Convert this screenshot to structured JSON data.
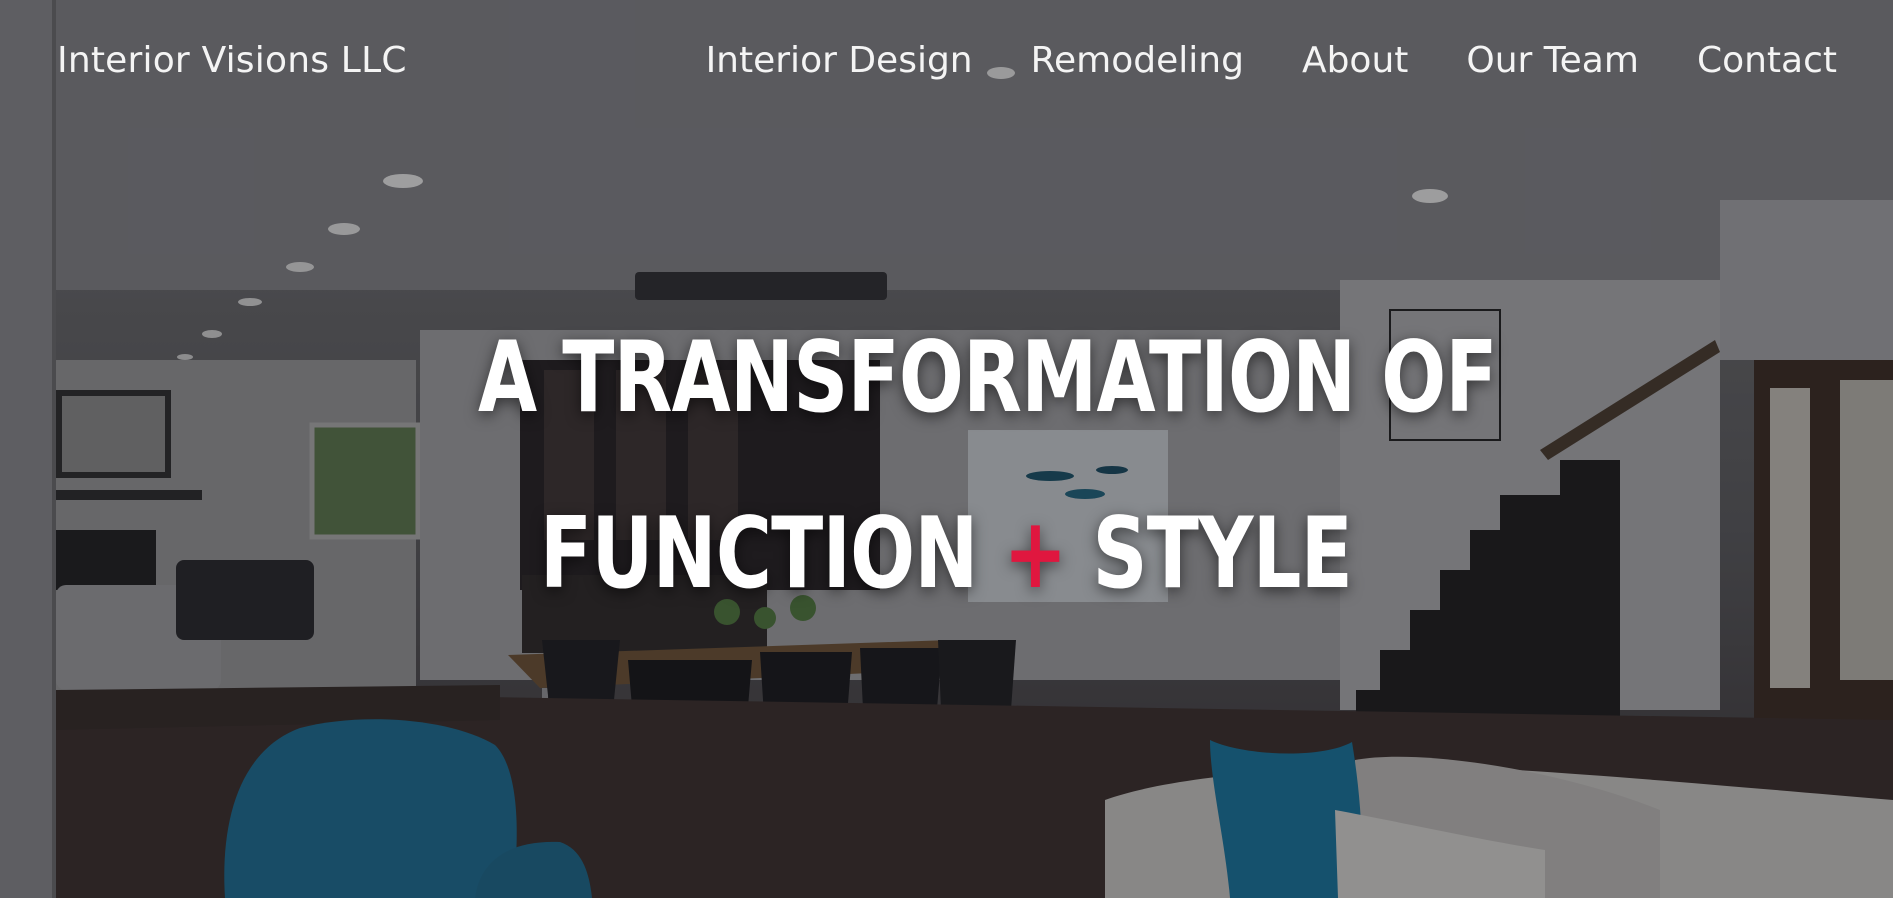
{
  "navbar": {
    "brand": "Interior Visions LLC",
    "links": [
      "Interior Design",
      "Remodeling",
      "About",
      "Our Team",
      "Contact"
    ]
  },
  "hero": {
    "headline_line1": "A TRANSFORMATION OF",
    "headline_line2_start": "FUNCTION",
    "headline_plus": "+",
    "headline_line2_end": "STYLE"
  },
  "colors": {
    "accent": "#e0173f",
    "text": "#ffffff",
    "chair_blue": "#1a6e96"
  }
}
